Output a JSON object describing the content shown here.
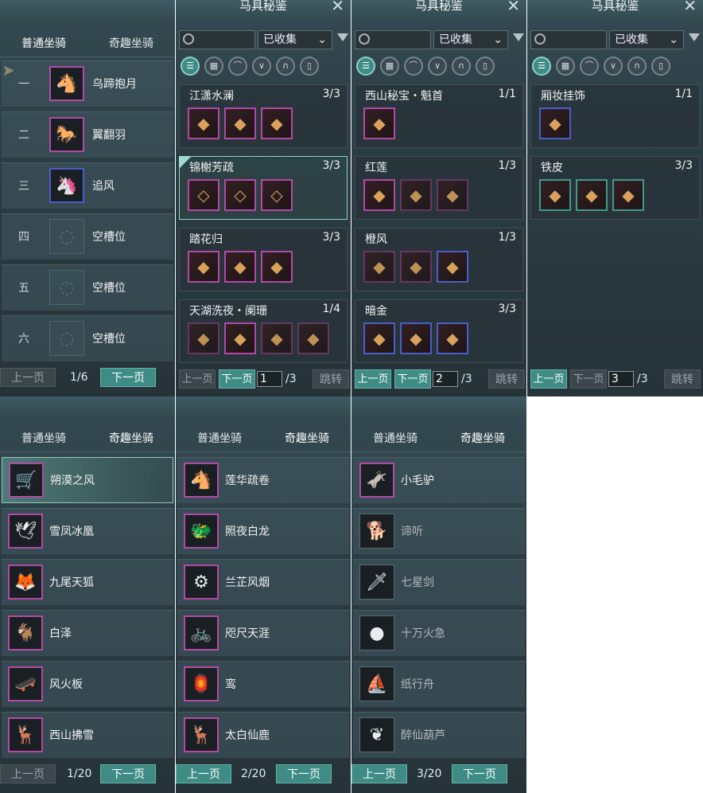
{
  "normal_panel": {
    "tabs": [
      "普通坐骑",
      "奇趣坐骑"
    ],
    "rows": [
      {
        "num": "一",
        "name": "乌蹄抱月",
        "icon": "white-horse",
        "state": "filled"
      },
      {
        "num": "二",
        "name": "翼翻羽",
        "icon": "black-horse",
        "state": "filled"
      },
      {
        "num": "三",
        "name": "追风",
        "icon": "white-horse-blue",
        "state": "filled"
      },
      {
        "num": "四",
        "name": "空槽位",
        "state": "empty"
      },
      {
        "num": "五",
        "name": "空槽位",
        "state": "empty"
      },
      {
        "num": "六",
        "name": "空槽位",
        "state": "empty"
      }
    ],
    "prev": "上一页",
    "page": "1/6",
    "next": "下一页"
  },
  "catalog_panels": [
    {
      "title": "马具秘鉴",
      "filter": "已收集",
      "prev": "上一页",
      "next": "下一页",
      "page_input": "1",
      "total": "/3",
      "jump": "跳转",
      "sets": [
        {
          "name": "江潇水澜",
          "count": "3/3",
          "items": [
            "purple",
            "purple",
            "purple"
          ]
        },
        {
          "name": "锦榭芳疏",
          "count": "3/3",
          "items": [
            "purple",
            "purple",
            "purple"
          ],
          "selected": true
        },
        {
          "name": "踏花归",
          "count": "3/3",
          "items": [
            "purple",
            "purple",
            "purple"
          ]
        },
        {
          "name": "天湖洗夜・阑珊",
          "count": "1/4",
          "items": [
            "dark",
            "purple",
            "dark",
            "dark"
          ]
        }
      ]
    },
    {
      "title": "马具秘鉴",
      "filter": "已收集",
      "prev": "上一页",
      "next": "下一页",
      "page_input": "2",
      "total": "/3",
      "jump": "跳转",
      "sets": [
        {
          "name": "西山秘宝・魁首",
          "count": "1/1",
          "items": [
            "purple"
          ]
        },
        {
          "name": "红莲",
          "count": "1/3",
          "items": [
            "purple",
            "dark",
            "dark"
          ]
        },
        {
          "name": "橙风",
          "count": "1/3",
          "items": [
            "dark",
            "dark",
            "blue"
          ]
        },
        {
          "name": "暗金",
          "count": "3/3",
          "items": [
            "blue",
            "blue",
            "blue"
          ]
        }
      ]
    },
    {
      "title": "马具秘鉴",
      "filter": "已收集",
      "prev": "上一页",
      "next": "下一页",
      "page_input": "3",
      "total": "/3",
      "jump": "跳转",
      "sets": [
        {
          "name": "厢妆挂饰",
          "count": "1/1",
          "items": [
            "blue"
          ]
        },
        {
          "name": "铁皮",
          "count": "3/3",
          "items": [
            "teal",
            "teal",
            "teal"
          ]
        }
      ]
    }
  ],
  "fun_panels": [
    {
      "tabs": [
        "普通坐骑",
        "奇趣坐骑"
      ],
      "prev": "上一页",
      "page": "1/20",
      "next": "下一页",
      "rows": [
        {
          "name": "朔漠之风",
          "selected": true
        },
        {
          "name": "雪凤冰凰"
        },
        {
          "name": "九尾天狐"
        },
        {
          "name": "白泽"
        },
        {
          "name": "风火板"
        },
        {
          "name": "西山拂雪"
        }
      ]
    },
    {
      "tabs": [
        "普通坐骑",
        "奇趣坐骑"
      ],
      "prev": "上一页",
      "page": "2/20",
      "next": "下一页",
      "rows": [
        {
          "name": "莲华疏卷"
        },
        {
          "name": "照夜白龙"
        },
        {
          "name": "兰芷风烟"
        },
        {
          "name": "咫尺天涯"
        },
        {
          "name": "鸾"
        },
        {
          "name": "太白仙鹿"
        }
      ]
    },
    {
      "tabs": [
        "普通坐骑",
        "奇趣坐骑"
      ],
      "prev": "上一页",
      "page": "3/20",
      "next": "下一页",
      "rows": [
        {
          "name": "小毛驴"
        },
        {
          "name": "谛听",
          "dim": true
        },
        {
          "name": "七星剑",
          "dim": true
        },
        {
          "name": "十万火急",
          "dim": true
        },
        {
          "name": "纸行舟",
          "dim": true
        },
        {
          "name": "醉仙葫芦",
          "dim": true
        }
      ]
    }
  ],
  "category_icons": [
    "list-icon",
    "grid-icon",
    "saddle-icon",
    "stirrup-icon",
    "horseshoe-icon",
    "armor-icon"
  ]
}
